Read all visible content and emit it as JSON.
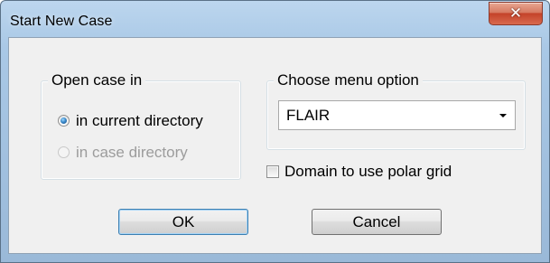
{
  "window": {
    "title": "Start New Case"
  },
  "title_bar_buttons": {
    "close_glyph": "✕"
  },
  "open_case_group": {
    "legend": "Open case in",
    "options": [
      {
        "label": "in current directory",
        "checked": true,
        "enabled": true
      },
      {
        "label": "in case directory",
        "checked": false,
        "enabled": false
      }
    ]
  },
  "menu_group": {
    "legend": "Choose menu option",
    "selected": "FLAIR"
  },
  "polar_grid_checkbox": {
    "label": "Domain to use polar grid",
    "checked": false
  },
  "buttons": {
    "ok": "OK",
    "cancel": "Cancel"
  },
  "colors": {
    "frame": "#a9c8e6",
    "client": "#f0f0f0",
    "close_button": "#c4432a",
    "default_button_border": "#3c7fb1"
  }
}
